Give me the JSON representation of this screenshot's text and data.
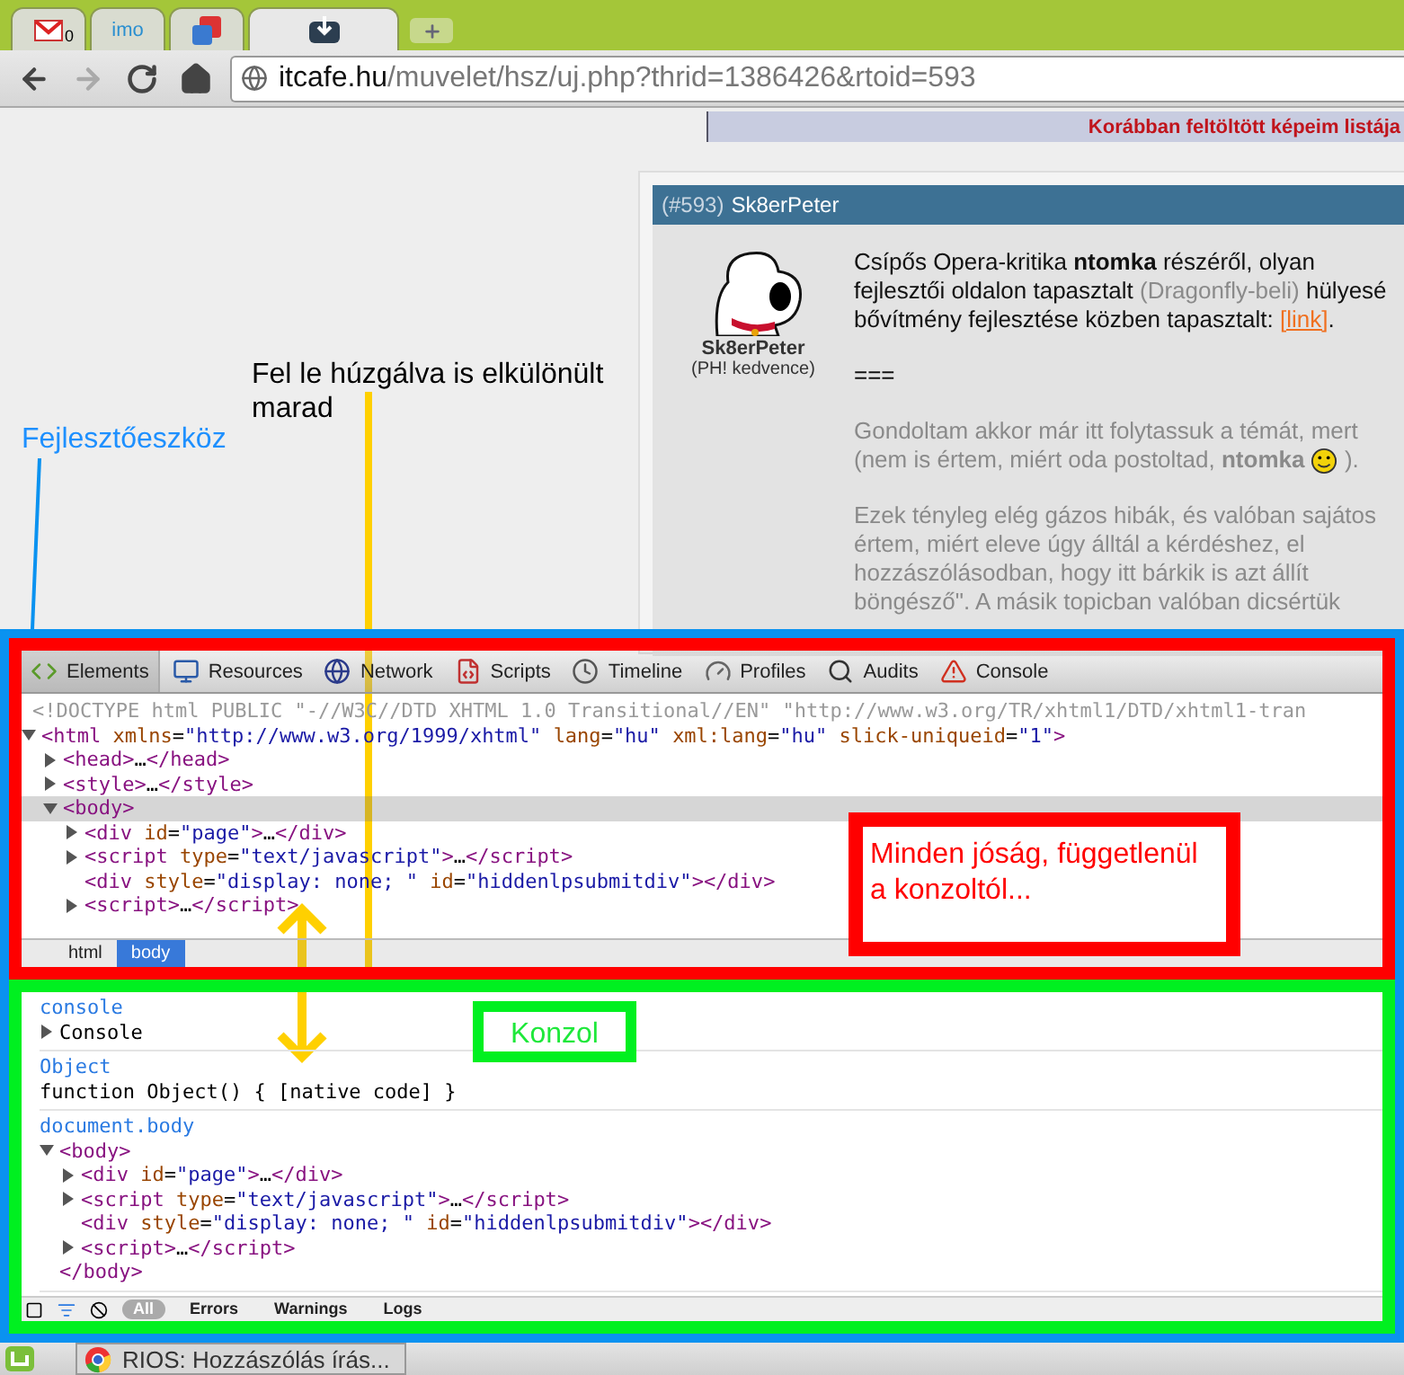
{
  "browser_tabs": [
    {
      "badge": "0",
      "selected": false
    },
    {
      "label": "imo",
      "selected": false
    },
    {
      "selected": false
    },
    {
      "selected": true
    }
  ],
  "nav_buttons": [
    {
      "kind": "back",
      "disabled": false
    },
    {
      "kind": "forward",
      "disabled": true
    },
    {
      "kind": "reload",
      "disabled": false
    },
    {
      "kind": "home",
      "disabled": false
    }
  ],
  "address": {
    "domain": "itcafe.hu",
    "path": "/muvelet/hsz/uj.php?thrid=1386426&rtoid=593"
  },
  "banner": "Korábban feltöltött képeim listája",
  "post": {
    "number": "(#593)",
    "author": "Sk8erPeter",
    "avatar_name": "Sk8erPeter",
    "avatar_title": "(PH! kedvence)",
    "paragraphs": [
      {
        "muted": false,
        "lines": [
          [
            {
              "kind": "text",
              "text": "Csípős Opera-kritika **ntomka** részéről, olyan"
            }
          ],
          [
            {
              "kind": "text",
              "text": "fejlesztői oldalon tapasztalt "
            },
            {
              "kind": "muted",
              "text": "(Dragonfly-beli)"
            },
            {
              "kind": "text",
              "text": " hülyesé"
            }
          ],
          [
            {
              "kind": "text",
              "text": "bővítmény fejlesztése közben tapasztalt: "
            },
            {
              "kind": "link",
              "text": "[link]"
            },
            {
              "kind": "text",
              "text": "."
            }
          ]
        ]
      },
      {
        "muted": false,
        "lines": [
          [
            {
              "kind": "text",
              "text": "==="
            }
          ]
        ]
      },
      {
        "muted": true,
        "lines": [
          [
            {
              "kind": "text",
              "text": "Gondoltam akkor már itt folytassuk a témát, mert"
            }
          ],
          [
            {
              "kind": "text",
              "text": "(nem is értem, miért oda postoltad, **ntomka** "
            },
            {
              "kind": "emoticon"
            },
            {
              "kind": "text",
              "text": " )."
            }
          ]
        ]
      },
      {
        "muted": true,
        "lines": [
          [
            {
              "kind": "text",
              "text": "Ezek tényleg elég gázos hibák, és valóban sajátos"
            }
          ],
          [
            {
              "kind": "text",
              "text": "értem, miért eleve úgy álltál a kérdéshez, el"
            }
          ],
          [
            {
              "kind": "text",
              "text": "hozzászólásodban, hogy itt bárkik is azt állít"
            }
          ],
          [
            {
              "kind": "text",
              "text": "böngésző\". A másik topicban valóban dicsértük"
            }
          ]
        ]
      }
    ]
  },
  "devtools": {
    "tabs": [
      {
        "label": "Elements",
        "selected": true
      },
      {
        "label": "Resources",
        "selected": false
      },
      {
        "label": "Network",
        "selected": false
      },
      {
        "label": "Scripts",
        "selected": false
      },
      {
        "label": "Timeline",
        "selected": false
      },
      {
        "label": "Profiles",
        "selected": false
      },
      {
        "label": "Audits",
        "selected": false
      },
      {
        "label": "Console",
        "selected": false
      }
    ],
    "doctype": "<!DOCTYPE html PUBLIC \"-//W3C//DTD XHTML 1.0 Transitional//EN\" \"http://www.w3.org/TR/xhtml1/DTD/xhtml1-tran",
    "dom": [
      {
        "text": "<html xmlns=\"http://www.w3.org/1999/xhtml\" lang=\"hu\" xml:lang=\"hu\" slick-uniqueid=\"1\">",
        "expanded": true,
        "selected": false,
        "children": [
          {
            "text": "<head>…</head>",
            "expanded": false,
            "selected": false
          },
          {
            "text": "<style>…</style>",
            "expanded": false,
            "selected": false
          },
          {
            "text": "<body>",
            "expanded": true,
            "selected": true,
            "children": [
              {
                "text": "<div id=\"page\">…</div>",
                "expanded": false,
                "selected": false
              },
              {
                "text": "<script type=\"text/javascript\">…</script>",
                "expanded": false,
                "selected": false
              },
              {
                "text": "<div style=\"display: none; \" id=\"hiddenlpsubmitdiv\"></div>",
                "selected": false
              },
              {
                "text": "<script>…</script>",
                "expanded": false,
                "selected": false
              }
            ]
          }
        ]
      }
    ],
    "breadcrumbs": [
      {
        "label": "html",
        "selected": false
      },
      {
        "label": "body",
        "selected": true
      }
    ],
    "console": [
      {
        "command": "console",
        "output": [
          {
            "text": "Console",
            "kind": "plain",
            "expanded": false
          }
        ]
      },
      {
        "command": "Object",
        "output": [
          {
            "text": "function Object() { [native code] }",
            "kind": "plain"
          }
        ]
      },
      {
        "command": "document.body",
        "output": [
          {
            "text": "<body>",
            "kind": "markup",
            "expanded": true,
            "closing": "</body>",
            "children": [
              {
                "text": "<div id=\"page\">…</div>",
                "kind": "markup",
                "expanded": false
              },
              {
                "text": "<script type=\"text/javascript\">…</script>",
                "kind": "markup",
                "expanded": false
              },
              {
                "text": "<div style=\"display: none; \" id=\"hiddenlpsubmitdiv\"></div>",
                "kind": "markup"
              },
              {
                "text": "<script>…</script>",
                "kind": "markup",
                "expanded": false
              }
            ]
          }
        ]
      }
    ],
    "console_filters": [
      {
        "label": "All",
        "selected": true
      },
      {
        "label": "Errors",
        "selected": false
      },
      {
        "label": "Warnings",
        "selected": false
      },
      {
        "label": "Logs",
        "selected": false
      }
    ]
  },
  "annotations": {
    "devtools_label": "Fejlesztőeszköz",
    "drag_note": "Fel le húzgálva is elkülönült marad",
    "elements_note": "Minden jóság, függetlenül a konzoltól...",
    "console_note": "Konzol"
  },
  "taskbar": {
    "tasks": [
      {
        "label": "RIOS: Hozzászólás írás..."
      }
    ]
  }
}
